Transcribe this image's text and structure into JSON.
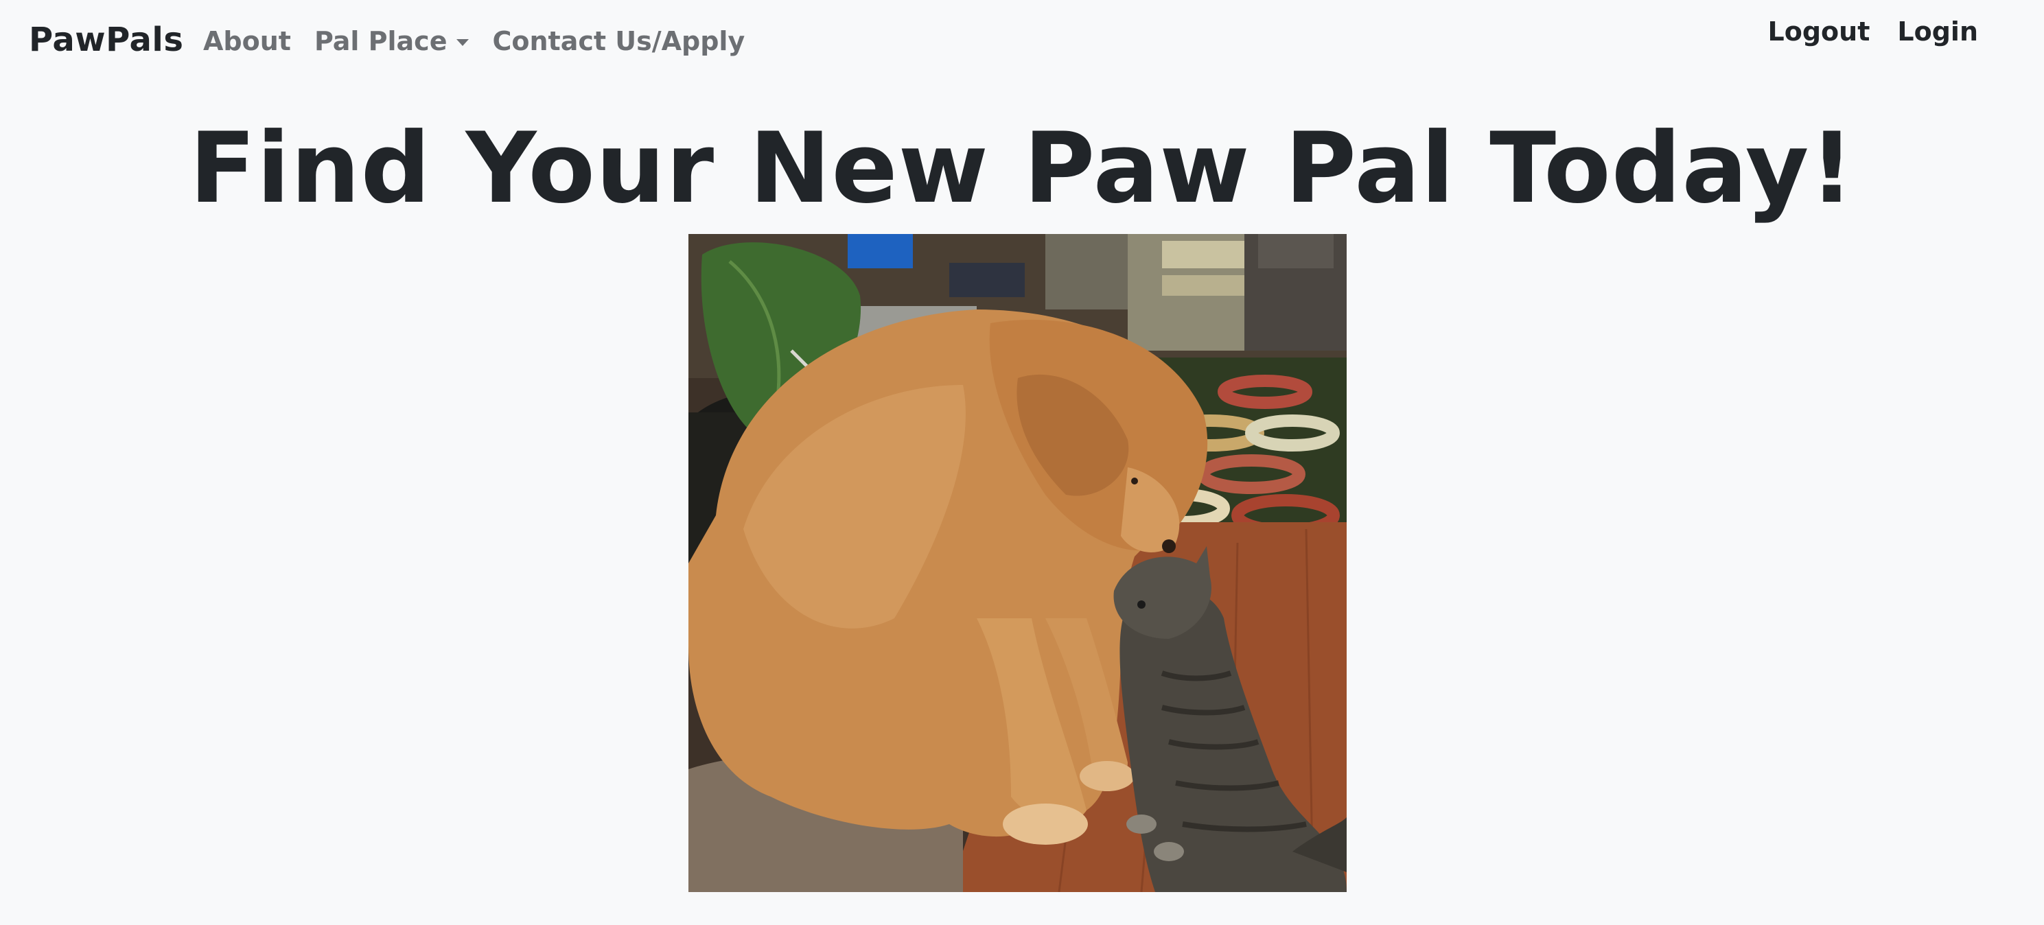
{
  "nav": {
    "brand": "PawPals",
    "links": [
      {
        "label": "About"
      },
      {
        "label": "Pal Place"
      },
      {
        "label": "Contact Us/Apply"
      }
    ],
    "auth": {
      "logout": "Logout",
      "login": "Login"
    }
  },
  "hero": {
    "title": "Find Your New Paw Pal Today!"
  }
}
